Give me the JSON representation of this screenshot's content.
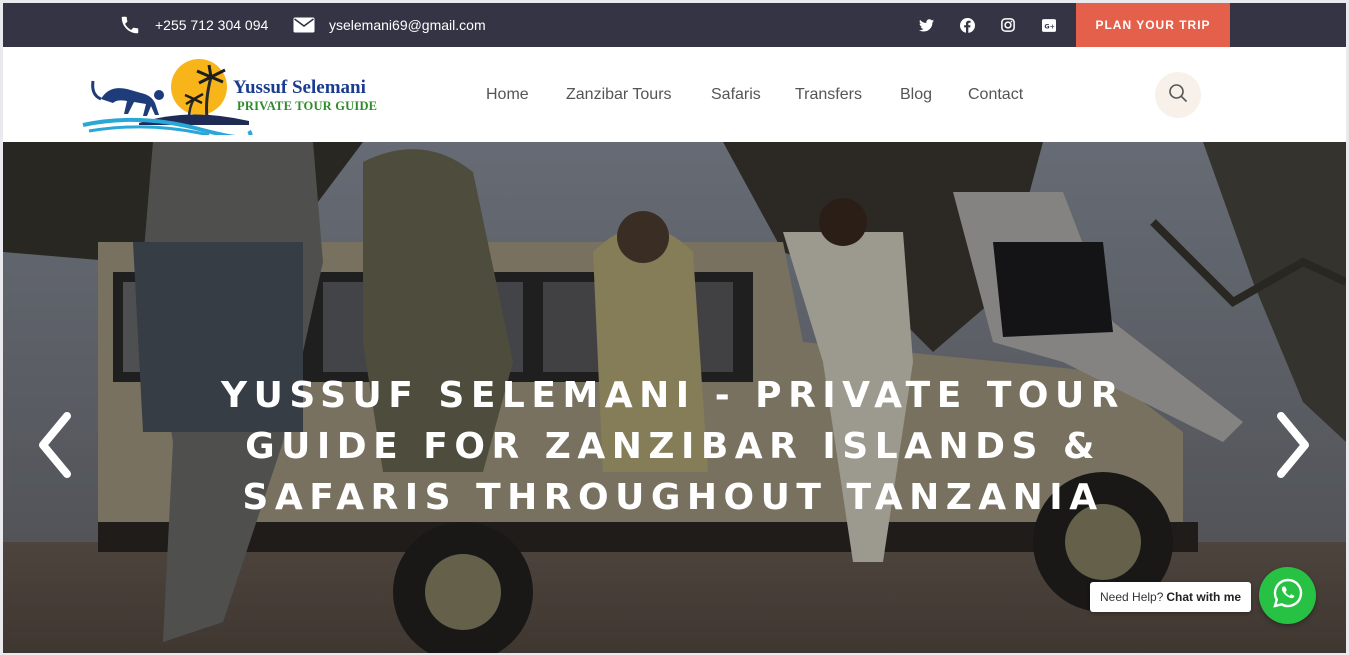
{
  "topbar": {
    "phone": "+255 712 304 094",
    "email": "yselemani69@gmail.com",
    "social_icons": [
      "twitter-icon",
      "facebook-icon",
      "instagram-icon",
      "google-plus-icon"
    ],
    "cta_label": "PLAN YOUR TRIP",
    "cta_color": "#e4604b",
    "background": "#353445"
  },
  "header": {
    "logo": {
      "title": "Yussuf Selemani",
      "subtitle": "PRIVATE TOUR GUIDE"
    },
    "nav": [
      "Home",
      "Zanzibar Tours",
      "Safaris",
      "Transfers",
      "Blog",
      "Contact"
    ],
    "search_icon": "search-icon"
  },
  "hero": {
    "title": "YUSSUF SELEMANI - PRIVATE TOUR GUIDE FOR ZANZIBAR ISLANDS & SAFARIS THROUGHOUT TANZANIA",
    "prev_icon": "chevron-left-icon",
    "next_icon": "chevron-right-icon"
  },
  "chat": {
    "prefix": "Need Help?",
    "action": "Chat with me",
    "icon": "whatsapp-icon",
    "color": "#27c144"
  }
}
